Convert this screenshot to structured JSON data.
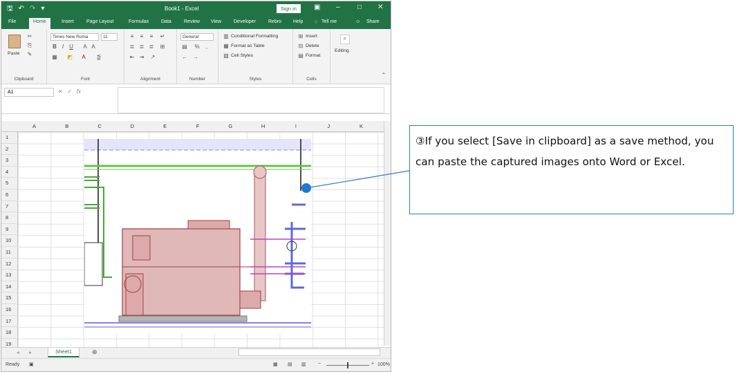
{
  "window": {
    "title": "Book1 - Excel",
    "sign_in": "Sign in"
  },
  "tabs": [
    "File",
    "Home",
    "Insert",
    "Page Layout",
    "Formulas",
    "Data",
    "Review",
    "View",
    "Developer",
    "Rebro",
    "Help",
    "Tell me",
    "Share"
  ],
  "ribbon": {
    "clipboard": {
      "paste": "Paste",
      "label": "Clipboard"
    },
    "font": {
      "name": "Times New Roma",
      "size": "11",
      "label": "Font"
    },
    "alignment": {
      "label": "Alignment"
    },
    "number": {
      "format": "General",
      "label": "Number"
    },
    "styles": {
      "conditional": "Conditional Formatting",
      "format_table": "Format as Table",
      "cell_styles": "Cell Styles",
      "label": "Styles"
    },
    "cells": {
      "insert": "Insert",
      "delete": "Delete",
      "format": "Format",
      "label": "Cells"
    },
    "editing": {
      "label": "Editing"
    }
  },
  "formula_bar": {
    "name_box": "A1",
    "fx": "fx"
  },
  "columns": [
    "A",
    "B",
    "C",
    "D",
    "E",
    "F",
    "G",
    "H",
    "I",
    "J",
    "K"
  ],
  "rows": [
    "1",
    "2",
    "3",
    "4",
    "5",
    "6",
    "7",
    "8",
    "9",
    "10",
    "11",
    "12",
    "13",
    "14",
    "15",
    "16",
    "17",
    "18",
    "19"
  ],
  "sheet": {
    "tab": "Sheet1"
  },
  "status": {
    "ready": "Ready",
    "zoom": "100%"
  },
  "callout": {
    "text": "③If you select [Save in clipboard] as a save method, you can paste the captured images onto Word or Excel."
  },
  "colors": {
    "excel_green": "#217346",
    "callout_border": "#2b7bc4",
    "dot": "#1e78d2"
  }
}
